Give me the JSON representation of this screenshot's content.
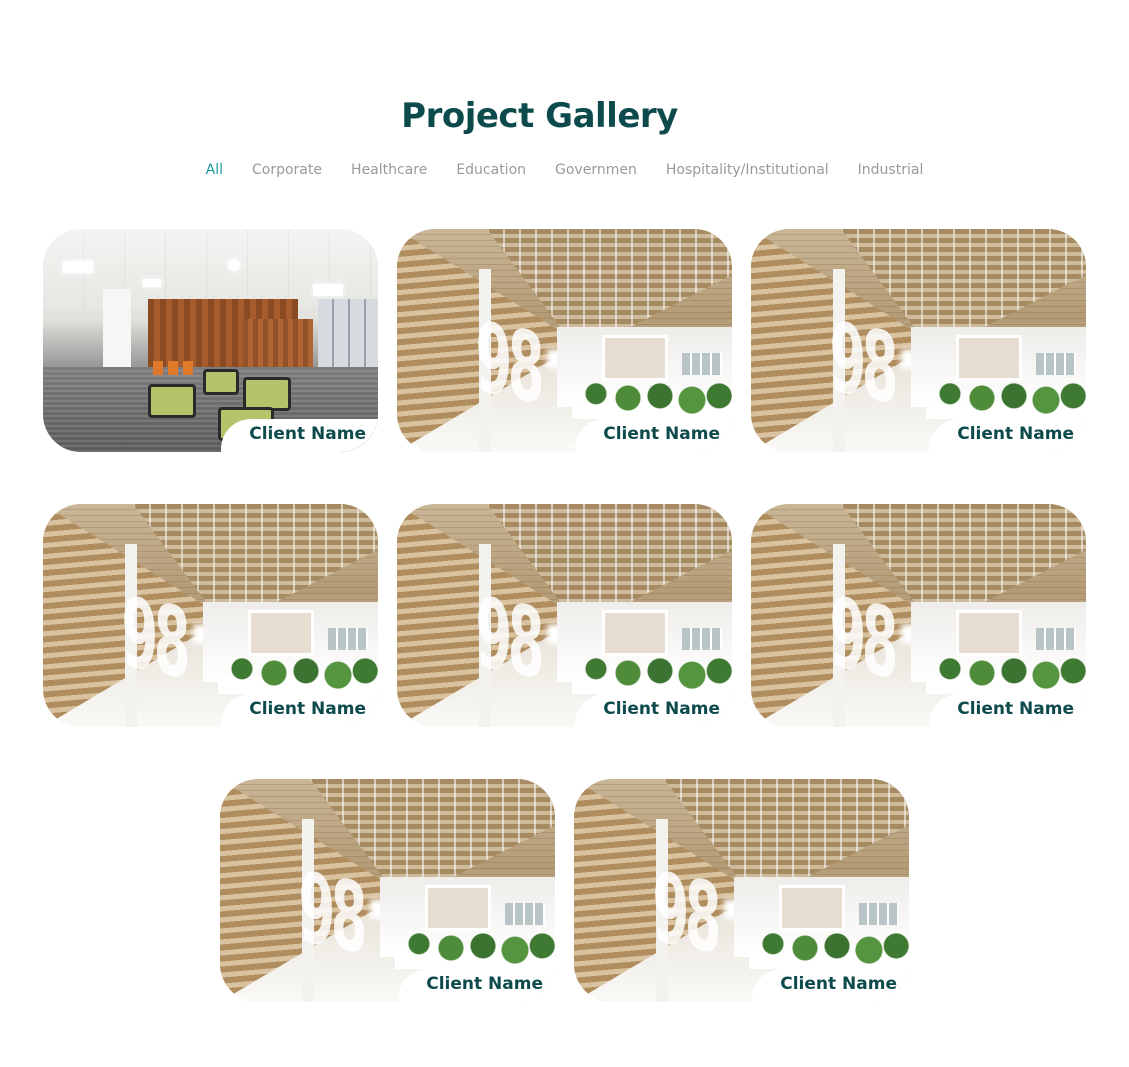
{
  "title": "Project Gallery",
  "filters": [
    {
      "label": "All",
      "active": true
    },
    {
      "label": "Corporate",
      "active": false
    },
    {
      "label": "Healthcare",
      "active": false
    },
    {
      "label": "Education",
      "active": false
    },
    {
      "label": "Governmen",
      "active": false
    },
    {
      "label": "Hospitality/Institutional",
      "active": false
    },
    {
      "label": "Industrial",
      "active": false
    }
  ],
  "projects": [
    {
      "client": "Client Name",
      "scene": "office-lounge"
    },
    {
      "client": "Client Name",
      "scene": "timber-corridor"
    },
    {
      "client": "Client Name",
      "scene": "timber-corridor"
    },
    {
      "client": "Client Name",
      "scene": "timber-corridor"
    },
    {
      "client": "Client Name",
      "scene": "timber-corridor"
    },
    {
      "client": "Client Name",
      "scene": "timber-corridor"
    },
    {
      "client": "Client Name",
      "scene": "timber-corridor"
    },
    {
      "client": "Client Name",
      "scene": "timber-corridor"
    }
  ],
  "colors": {
    "title": "#0d4a4c",
    "active_filter": "#1a9aa0",
    "inactive_filter": "#9a9a9a",
    "caption": "#0d4a4c"
  }
}
